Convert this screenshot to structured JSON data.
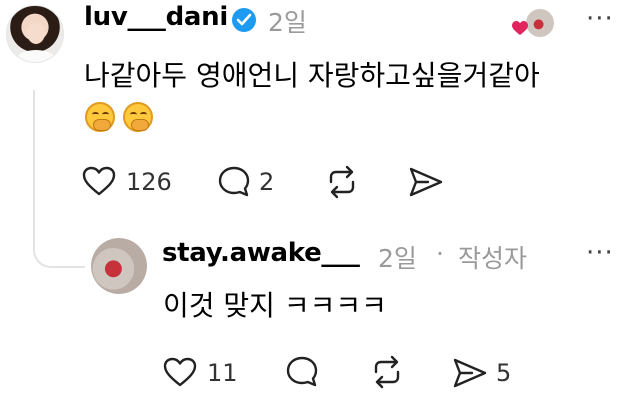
{
  "post": {
    "username": "luv___dani",
    "time": "2일",
    "text": "나같아두 영애언니 자랑하고싶을거같아",
    "emoji": [
      "hand-over-mouth-emoji",
      "hand-over-mouth-emoji"
    ],
    "actions": {
      "likes": "126",
      "replies": "2"
    }
  },
  "reply": {
    "username": "stay.awake___",
    "time": "2일",
    "separator": "·",
    "badge": "작성자",
    "text": "이것 맞지 ㅋㅋㅋㅋ",
    "actions": {
      "likes": "11",
      "shares": "5"
    }
  },
  "more_label": "···",
  "colors": {
    "verified": "#1d9bf0",
    "heart": "#e0245e",
    "secondary_text": "#9a9a9a"
  },
  "icons": [
    "verified-badge-icon",
    "heart-icon",
    "comment-icon",
    "repost-icon",
    "share-icon",
    "more-icon"
  ]
}
